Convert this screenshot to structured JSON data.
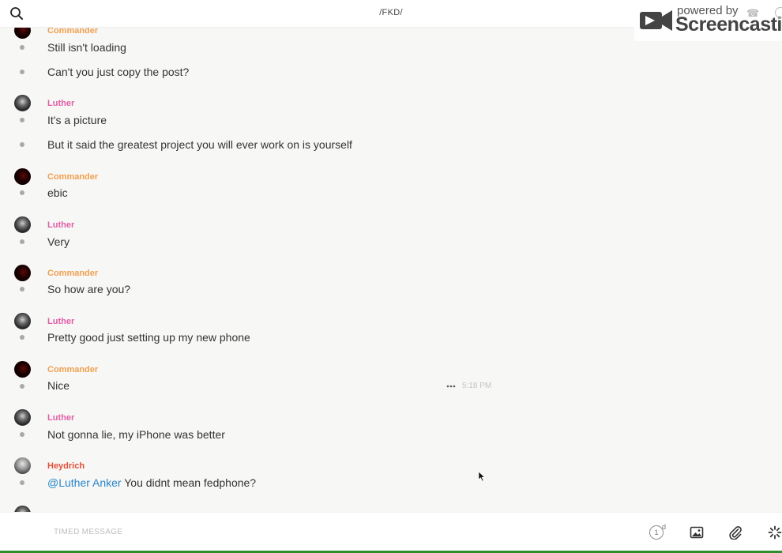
{
  "header": {
    "title": "/FKD/",
    "search_icon": "search-icon"
  },
  "watermark": {
    "powered": "powered by",
    "brand": "Screencastify"
  },
  "messages": [
    {
      "author": "Commander",
      "lines": [
        "Still isn't loading",
        "Can't you just copy the post?"
      ]
    },
    {
      "author": "Luther",
      "lines": [
        "It's a picture",
        "But it said the greatest project you will ever work on is yourself"
      ]
    },
    {
      "author": "Commander",
      "lines": [
        "ebic"
      ]
    },
    {
      "author": "Luther",
      "lines": [
        "Very"
      ]
    },
    {
      "author": "Commander",
      "lines": [
        "So how are you?"
      ]
    },
    {
      "author": "Luther",
      "lines": [
        "Pretty good just setting up my new phone"
      ]
    },
    {
      "author": "Commander",
      "lines": [
        "Nice"
      ],
      "time": "5:18 PM"
    },
    {
      "author": "Luther",
      "lines": [
        "Not gonna lie, my iPhone was better"
      ]
    },
    {
      "author": "Heydrich",
      "mention": "@Luther Anker",
      "lines": [
        " You didnt mean fedphone?"
      ]
    }
  ],
  "composer": {
    "placeholder": "TIMED MESSAGE",
    "timer_value": "1",
    "timer_unit": "d",
    "icons": [
      "image-icon",
      "paperclip-icon",
      "spinner-icon"
    ]
  },
  "colors": {
    "commander": "#f0a050",
    "luther": "#e05fa8",
    "heydrich": "#e0503a",
    "mention": "#2a86c9"
  }
}
